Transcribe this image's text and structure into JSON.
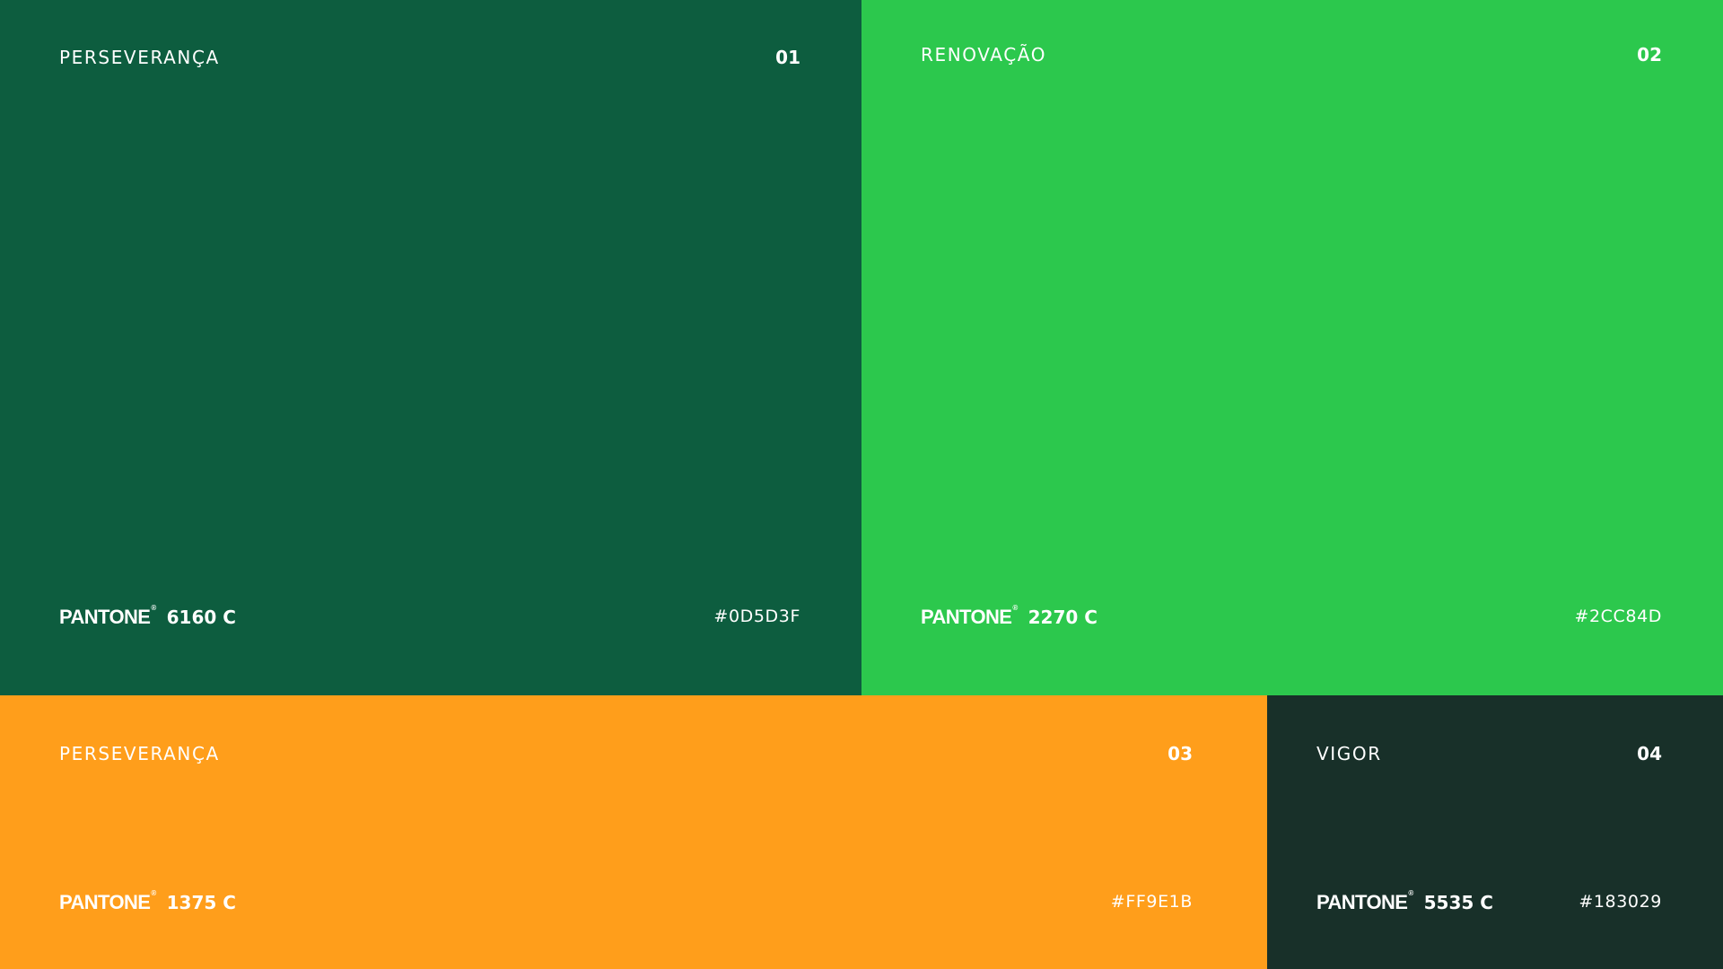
{
  "swatches": [
    {
      "name": "PERSEVERANÇA",
      "number": "01",
      "pantone_brand": "PANTONE",
      "pantone_code": "6160 C",
      "hex": "#0D5D3F",
      "color": "#0D5D3F"
    },
    {
      "name": "RENOVAÇÃO",
      "number": "02",
      "pantone_brand": "PANTONE",
      "pantone_code": "2270 C",
      "hex": "#2CC84D",
      "color": "#2CC84D"
    },
    {
      "name": "PERSEVERANÇA",
      "number": "03",
      "pantone_brand": "PANTONE",
      "pantone_code": "1375 C",
      "hex": "#FF9E1B",
      "color": "#FF9E1B"
    },
    {
      "name": "VIGOR",
      "number": "04",
      "pantone_brand": "PANTONE",
      "pantone_code": "5535 C",
      "hex": "#183029",
      "color": "#183029"
    }
  ],
  "registered_mark": "®"
}
